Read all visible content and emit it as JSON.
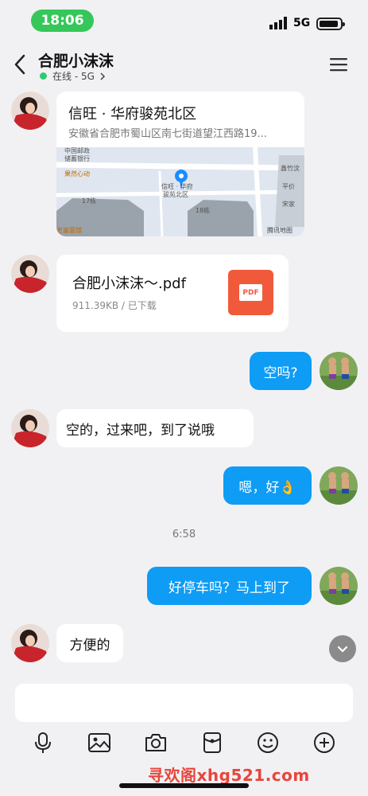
{
  "status_bar": {
    "time": "18:06",
    "network": "5G"
  },
  "header": {
    "title": "合肥小沫沫",
    "subtitle": "在线 - 5G"
  },
  "location_card": {
    "title": "信旺 · 华府骏苑北区",
    "address": "安徽省合肥市蜀山区南七街道望江西路19...",
    "map_labels": {
      "post": "中国邮政",
      "bank": "储蓄银行",
      "cafe": "果然心动",
      "bldg1": "17栋",
      "bldg2": "18栋",
      "place1": "信旺 · 华府",
      "place2": "骏苑北区",
      "poi1": "鑫竹汶",
      "poi2": "平价",
      "poi3": "宋家",
      "corner": "老富面馆",
      "provider": "腾讯地图"
    }
  },
  "file_card": {
    "name": "合肥小沫沫～.pdf",
    "meta": "911.39KB / 已下载",
    "icon_text": "PDF"
  },
  "messages": {
    "out1": "空吗?",
    "in1": "空的，过来吧，到了说哦",
    "out2": "嗯，好👌",
    "timestamp": "6:58",
    "out3": "好停车吗？马上到了",
    "in2": "方便的"
  },
  "watermark": "寻欢阁xhg521.com",
  "colors": {
    "accent": "#0e9cf5",
    "time_pill": "#35c759",
    "online_dot": "#2ecc71",
    "pdf_red": "#f05a3a",
    "watermark": "#e8453c"
  },
  "icons": {
    "back": "chevron-left-icon",
    "menu": "hamburger-menu-icon",
    "voice": "microphone-icon",
    "image": "image-icon",
    "camera": "camera-icon",
    "red_packet": "red-packet-icon",
    "emoji": "emoji-icon",
    "plus": "plus-circle-icon",
    "scroll": "scroll-down-icon"
  }
}
